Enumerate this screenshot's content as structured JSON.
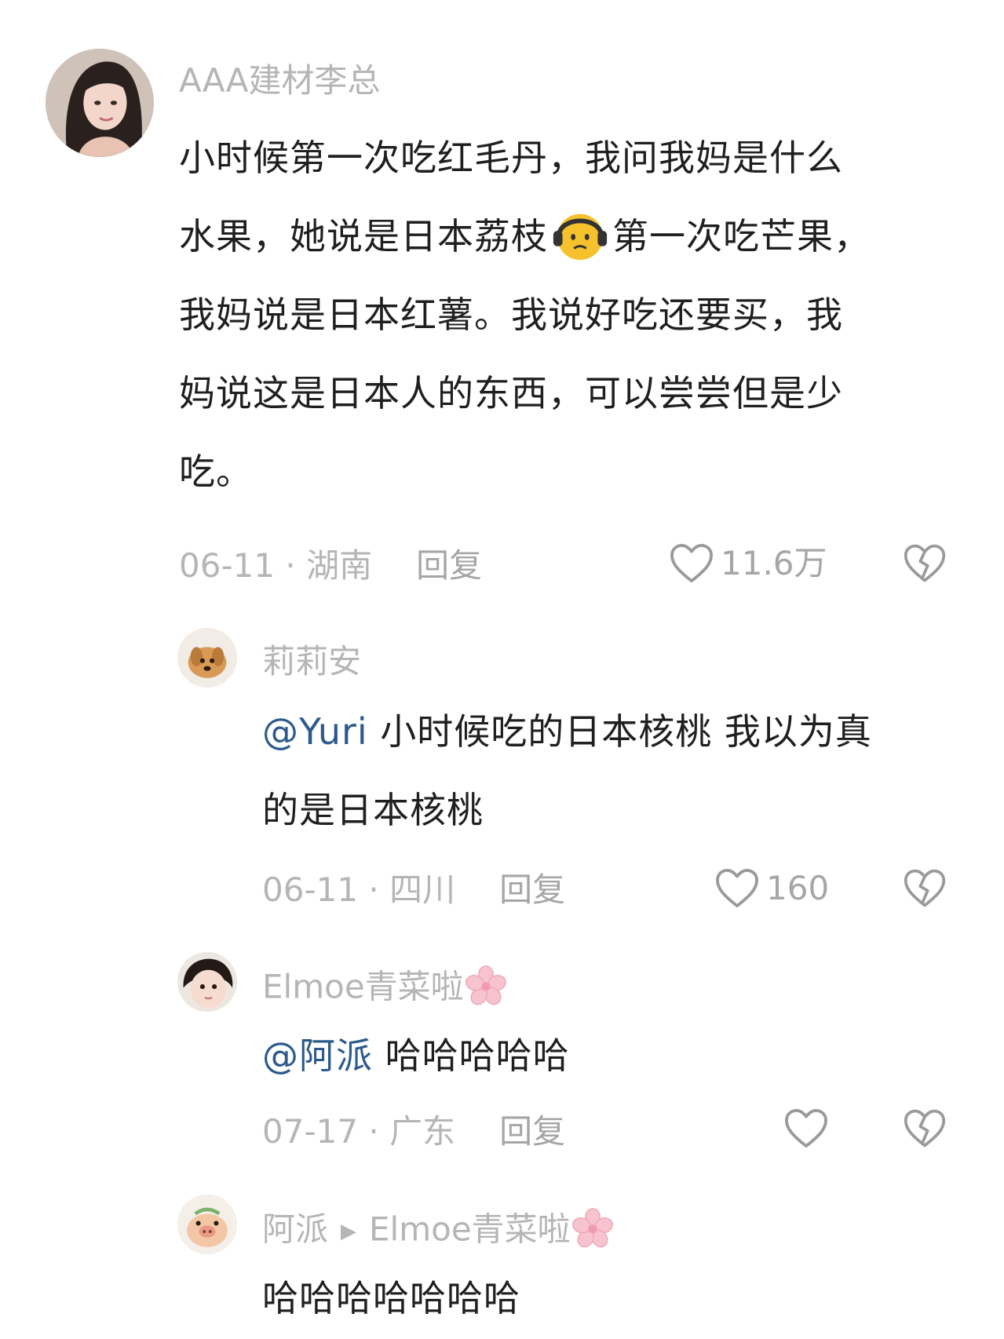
{
  "comments": [
    {
      "username": "AAA建材李总",
      "text_lines": [
        "小时候第一次吃红毛丹，我问我妈是什么",
        "水果，她说是日本荔枝",
        "第一次吃芒果，",
        "我妈说是日本红薯。我说好吃还要买，我",
        "妈说这是日本人的东西，可以尝尝但是少",
        "吃。"
      ],
      "emoji": "headphones-face-emoji",
      "date_location": "06-11 · 湖南",
      "reply_label": "回复",
      "like_count": "11.6万"
    },
    {
      "username": "莉莉安",
      "mention": "@Yuri",
      "text_lines": [
        " 小时候吃的日本核桃 我以为真",
        "的是日本核桃"
      ],
      "date_location": "06-11 · 四川",
      "reply_label": "回复",
      "like_count": "160"
    },
    {
      "username": "Elmoe青菜啦",
      "username_emoji": "cherry-blossom-emoji",
      "mention": "@阿派",
      "text": " 哈哈哈哈哈",
      "date_location": "07-17 · 广东",
      "reply_label": "回复",
      "like_count": ""
    },
    {
      "username": "阿派",
      "reply_to": "Elmoe青菜啦",
      "reply_to_emoji": "cherry-blossom-emoji",
      "text": "哈哈哈哈哈哈哈"
    }
  ],
  "colors": {
    "username": "#b5b5b5",
    "mention": "#2c5a8c",
    "body_text": "#1f1f1f",
    "meta": "#b5b5b5"
  }
}
